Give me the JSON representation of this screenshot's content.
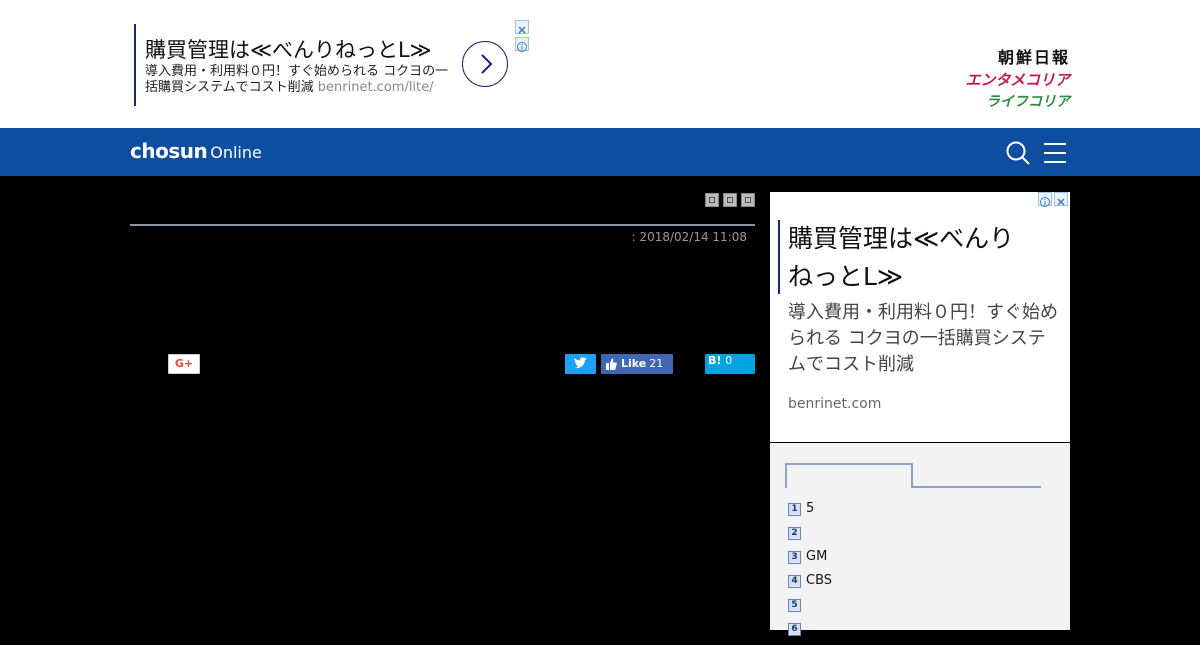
{
  "top_ad": {
    "title": "購買管理は≪べんりねっとL≫",
    "desc": "導入費用・利用料０円！すぐ始められる コクヨの一括購買システムでコスト削減",
    "url": "benrinet.com/lite/"
  },
  "brands": [
    "朝鮮日報",
    "エンタメコリア",
    "ライフコリア"
  ],
  "nav": {
    "logo_bold": "chosun",
    "logo_light": "Online"
  },
  "article": {
    "date": ": 2018/02/14 11:08",
    "share": {
      "gplus": "G+",
      "fb_like": "Like",
      "fb_count": "21",
      "hatena": "B!",
      "hatena_count": "0"
    }
  },
  "side_ad": {
    "title": "購買管理は≪べんりねっとL≫",
    "desc": "導入費用・利用料０円！すぐ始められる コクヨの一括購買システムでコスト削減",
    "url": "benrinet.com"
  },
  "ranking": [
    {
      "num": "1",
      "text": "5"
    },
    {
      "num": "2",
      "text": ""
    },
    {
      "num": "3",
      "text": "GM"
    },
    {
      "num": "4",
      "text": "CBS"
    },
    {
      "num": "5",
      "text": ""
    },
    {
      "num": "6",
      "text": ""
    }
  ],
  "colors": {
    "nav": "#0d4ea1",
    "ad_border": "#1a237e",
    "twitter": "#1da1f2",
    "facebook": "#4267b2",
    "hatena": "#00a4de"
  }
}
